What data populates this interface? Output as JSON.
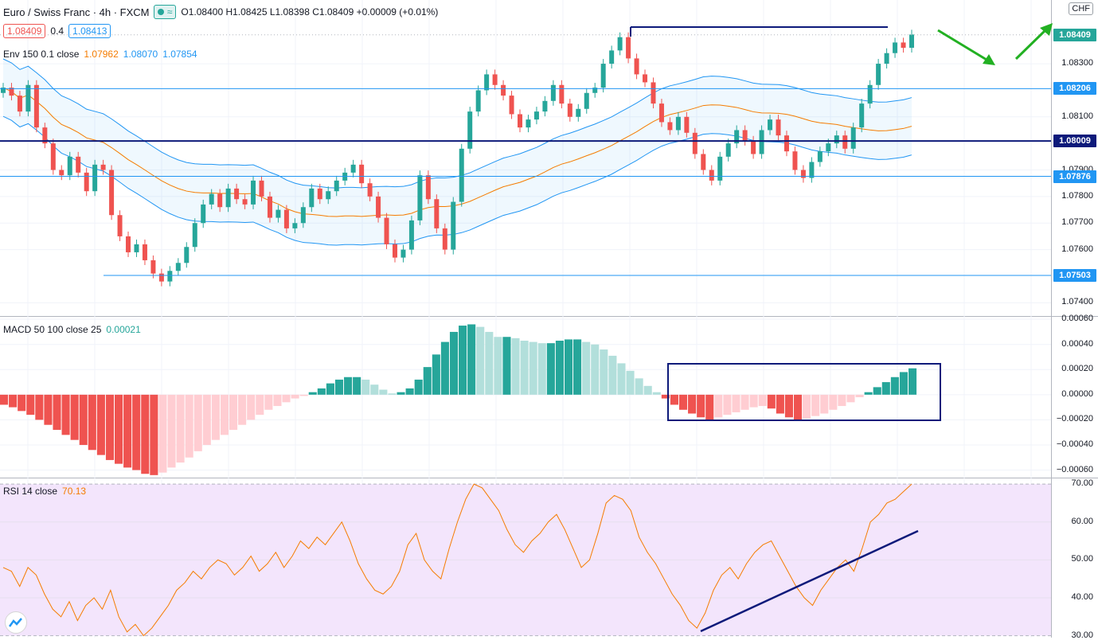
{
  "header": {
    "symbol": "Euro / Swiss Franc · 4h · FXCM",
    "ohlc": "O1.08400  H1.08425  L1.08398  C1.08409  +0.00009 (+0.01%)",
    "bid": "1.08409",
    "spread": "0.4",
    "ask": "1.08413",
    "currency": "CHF"
  },
  "envelope_legend": {
    "label": "Env 150 0.1 close",
    "v1": "1.07962",
    "v2": "1.08070",
    "v3": "1.07854"
  },
  "macd_legend": {
    "label": "MACD 50 100 close 25",
    "value": "0.00021"
  },
  "rsi_legend": {
    "label": "RSI 14 close",
    "value": "70.13"
  },
  "price_axis_labels": [
    "1.08300",
    "1.08100",
    "1.07900",
    "1.07800",
    "1.07700",
    "1.07600",
    "1.07400"
  ],
  "macd_axis_labels": [
    "0.00060",
    "0.00040",
    "0.00020",
    "0.00000",
    "−0.00020",
    "−0.00040",
    "−0.00060"
  ],
  "rsi_axis_labels": [
    "70.00",
    "60.00",
    "50.00",
    "40.00",
    "30.00"
  ],
  "price_tags": [
    {
      "text": "1.08409",
      "color": "#26a69a"
    },
    {
      "text": "1.08206",
      "color": "#2196f3"
    },
    {
      "text": "1.08009",
      "color": "#0d1a7a"
    },
    {
      "text": "1.07876",
      "color": "#2196f3"
    },
    {
      "text": "1.07503",
      "color": "#2196f3"
    }
  ],
  "colors": {
    "bull": "#26a69a",
    "bear": "#ef5350",
    "env_mid": "#f57c00",
    "env_band": "#2196f3",
    "draw": "#0d1a7a",
    "arrow": "#22b022",
    "rsi_line": "#f57c00",
    "rsi_fill": "#f3e5fc",
    "macd_up_strong": "#26a69a",
    "macd_up_weak": "#b2dfdb",
    "macd_dn_strong": "#ef5350",
    "macd_dn_weak": "#ffcdd2"
  },
  "chart_data": [
    {
      "type": "candlestick",
      "title": "Euro / Swiss Franc · 4h · FXCM",
      "ylim": [
        1.0735,
        1.0854
      ],
      "horizontal_levels": [
        1.08409,
        1.08206,
        1.08009,
        1.07876,
        1.07503
      ],
      "close_series_approx": [
        1.0821,
        1.0818,
        1.0812,
        1.0822,
        1.0806,
        1.08,
        1.079,
        1.0788,
        1.0795,
        1.0789,
        1.0782,
        1.0792,
        1.079,
        1.0773,
        1.0765,
        1.0759,
        1.0762,
        1.0756,
        1.0751,
        1.0748,
        1.0752,
        1.0755,
        1.0761,
        1.077,
        1.0777,
        1.0781,
        1.0776,
        1.0783,
        1.0779,
        1.0777,
        1.0786,
        1.078,
        1.0772,
        1.0775,
        1.0768,
        1.077,
        1.0776,
        1.0783,
        1.0779,
        1.0782,
        1.0786,
        1.0789,
        1.0792,
        1.0785,
        1.078,
        1.0772,
        1.0762,
        1.0757,
        1.076,
        1.0771,
        1.0788,
        1.0779,
        1.0768,
        1.076,
        1.0778,
        1.0798,
        1.0812,
        1.082,
        1.0826,
        1.0822,
        1.0818,
        1.0811,
        1.0806,
        1.0809,
        1.0812,
        1.0816,
        1.0822,
        1.0815,
        1.081,
        1.0813,
        1.0819,
        1.0821,
        1.083,
        1.0835,
        1.084,
        1.0832,
        1.0826,
        1.0823,
        1.0815,
        1.0808,
        1.0805,
        1.081,
        1.0804,
        1.0796,
        1.079,
        1.0786,
        1.0795,
        1.08,
        1.0805,
        1.0801,
        1.0796,
        1.0805,
        1.0809,
        1.0803,
        1.0797,
        1.079,
        1.0787,
        1.0793,
        1.0797,
        1.08,
        1.0803,
        1.0798,
        1.0806,
        1.0815,
        1.0822,
        1.083,
        1.0834,
        1.0838,
        1.0836,
        1.0841
      ]
    },
    {
      "type": "bar",
      "title": "MACD 50 100 close 25",
      "ylim": [
        -0.00066,
        0.00062
      ],
      "values_approx": [
        -8e-05,
        -0.0001,
        -0.00013,
        -0.00016,
        -0.0002,
        -0.00024,
        -0.00028,
        -0.00032,
        -0.00036,
        -0.0004,
        -0.00044,
        -0.00048,
        -0.00052,
        -0.00055,
        -0.00058,
        -0.0006,
        -0.00063,
        -0.00064,
        -0.00062,
        -0.00058,
        -0.00054,
        -0.0005,
        -0.00045,
        -0.0004,
        -0.00036,
        -0.00032,
        -0.00028,
        -0.00024,
        -0.0002,
        -0.00016,
        -0.00012,
        -9e-05,
        -6e-05,
        -3e-05,
        -1e-05,
        2e-05,
        5e-05,
        9e-05,
        0.00012,
        0.00014,
        0.00014,
        0.00012,
        8e-05,
        4e-05,
        1e-05,
        2e-05,
        5e-05,
        0.00012,
        0.00022,
        0.00032,
        0.00042,
        0.0005,
        0.00055,
        0.00056,
        0.00054,
        0.0005,
        0.00046,
        0.00046,
        0.00045,
        0.00043,
        0.00042,
        0.00041,
        0.00041,
        0.00043,
        0.00044,
        0.00044,
        0.00042,
        0.0004,
        0.00036,
        0.00031,
        0.00025,
        0.00019,
        0.00013,
        7e-05,
        2e-05,
        -3e-05,
        -8e-05,
        -0.00012,
        -0.00015,
        -0.00018,
        -0.0002,
        -0.00018,
        -0.00016,
        -0.00014,
        -0.00012,
        -0.0001,
        -9e-05,
        -0.00011,
        -0.00015,
        -0.00018,
        -0.0002,
        -0.00019,
        -0.00017,
        -0.00015,
        -0.00012,
        -9e-05,
        -6e-05,
        -2e-05,
        2e-05,
        6e-05,
        0.0001,
        0.00014,
        0.00018,
        0.00021
      ]
    },
    {
      "type": "line",
      "title": "RSI 14 close",
      "ylim": [
        29.5,
        71.5
      ],
      "values_approx": [
        48,
        47,
        43,
        48,
        46,
        41,
        37,
        35,
        39,
        34,
        38,
        40,
        37,
        42,
        35,
        31,
        33,
        30,
        32,
        35,
        38,
        42,
        44,
        47,
        45,
        48,
        50,
        49,
        46,
        48,
        51,
        47,
        49,
        52,
        48,
        51,
        55,
        53,
        56,
        54,
        57,
        60,
        55,
        49,
        45,
        42,
        41,
        43,
        47,
        54,
        57,
        50,
        47,
        45,
        53,
        60,
        66,
        70,
        69,
        66,
        63,
        58,
        54,
        52,
        55,
        57,
        60,
        62,
        58,
        53,
        48,
        50,
        57,
        65,
        67,
        66,
        63,
        56,
        52,
        49,
        45,
        41,
        38,
        34,
        32,
        36,
        42,
        46,
        48,
        45,
        49,
        52,
        54,
        55,
        51,
        47,
        43,
        40,
        38,
        42,
        45,
        48,
        50,
        47,
        53,
        60,
        62,
        65,
        66,
        68,
        70
      ]
    }
  ]
}
